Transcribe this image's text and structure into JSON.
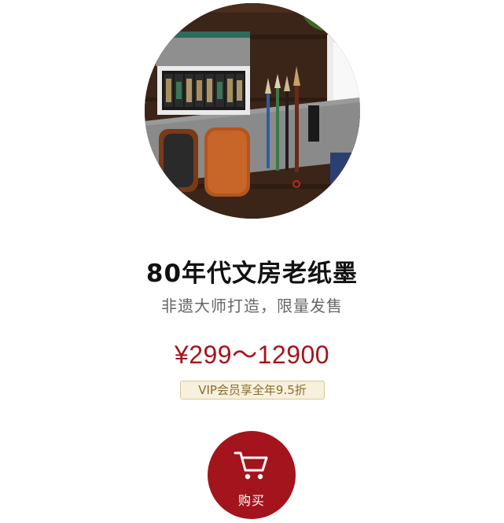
{
  "product": {
    "image_alt": "ink sticks, inkstones and brushes on a dark wooden table",
    "title": "80年代文房老纸墨",
    "subtitle": "非遗大师打造，限量发售",
    "price": "¥299～12900",
    "vip_note": "VIP会员享全年9.5折"
  },
  "actions": {
    "buy_label": "购买",
    "buy_icon": "shopping-cart-icon"
  },
  "colors": {
    "accent": "#a3141c",
    "price": "#a6141a",
    "badge_bg": "#f7f0dc",
    "badge_border": "#d9c79a"
  }
}
